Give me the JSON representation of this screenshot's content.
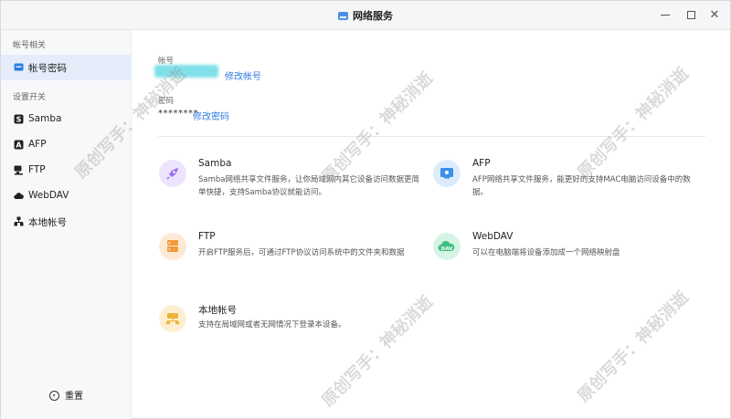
{
  "window": {
    "title": "网络服务",
    "app_icon": "network-service-icon"
  },
  "sidebar": {
    "section_account": "帐号相关",
    "item_account_password": "帐号密码",
    "section_settings": "设置开关",
    "items": [
      {
        "label": "Samba",
        "icon": "samba-icon"
      },
      {
        "label": "AFP",
        "icon": "afp-icon"
      },
      {
        "label": "FTP",
        "icon": "ftp-icon"
      },
      {
        "label": "WebDAV",
        "icon": "cloud-icon"
      },
      {
        "label": "本地帐号",
        "icon": "local-account-icon"
      }
    ],
    "reset_label": "重置"
  },
  "account": {
    "label": "帐号",
    "edit_link": "修改帐号",
    "password_label": "密码",
    "password_mask": "********",
    "password_edit_link": "修改密码"
  },
  "services": [
    {
      "name": "Samba",
      "desc": "Samba网络共享文件服务，让你局域网内其它设备访问数据更简单快捷，支持Samba协议就能访问。",
      "icon": "rocket-icon",
      "color": "#9b6cf2"
    },
    {
      "name": "AFP",
      "desc": "AFP网络共享文件服务，能更好的支持MAC电脑访问设备中的数据。",
      "icon": "mac-monitor-icon",
      "color": "#3b8fe8"
    },
    {
      "name": "FTP",
      "desc": "开启FTP服务后，可通过FTP协议访问系统中的文件夹和数据",
      "icon": "ftp-server-icon",
      "color": "#f39a3a"
    },
    {
      "name": "WebDAV",
      "desc": "可以在电脑端将设备添加成一个网络映射盘",
      "icon": "dav-cloud-icon",
      "color": "#3cc07e"
    },
    {
      "name": "本地帐号",
      "desc": "支持在局域网或者无网情况下登录本设备。",
      "icon": "local-account-badge-icon",
      "color": "#f0b43a"
    }
  ],
  "watermark": "原创写手：神秘消逝"
}
